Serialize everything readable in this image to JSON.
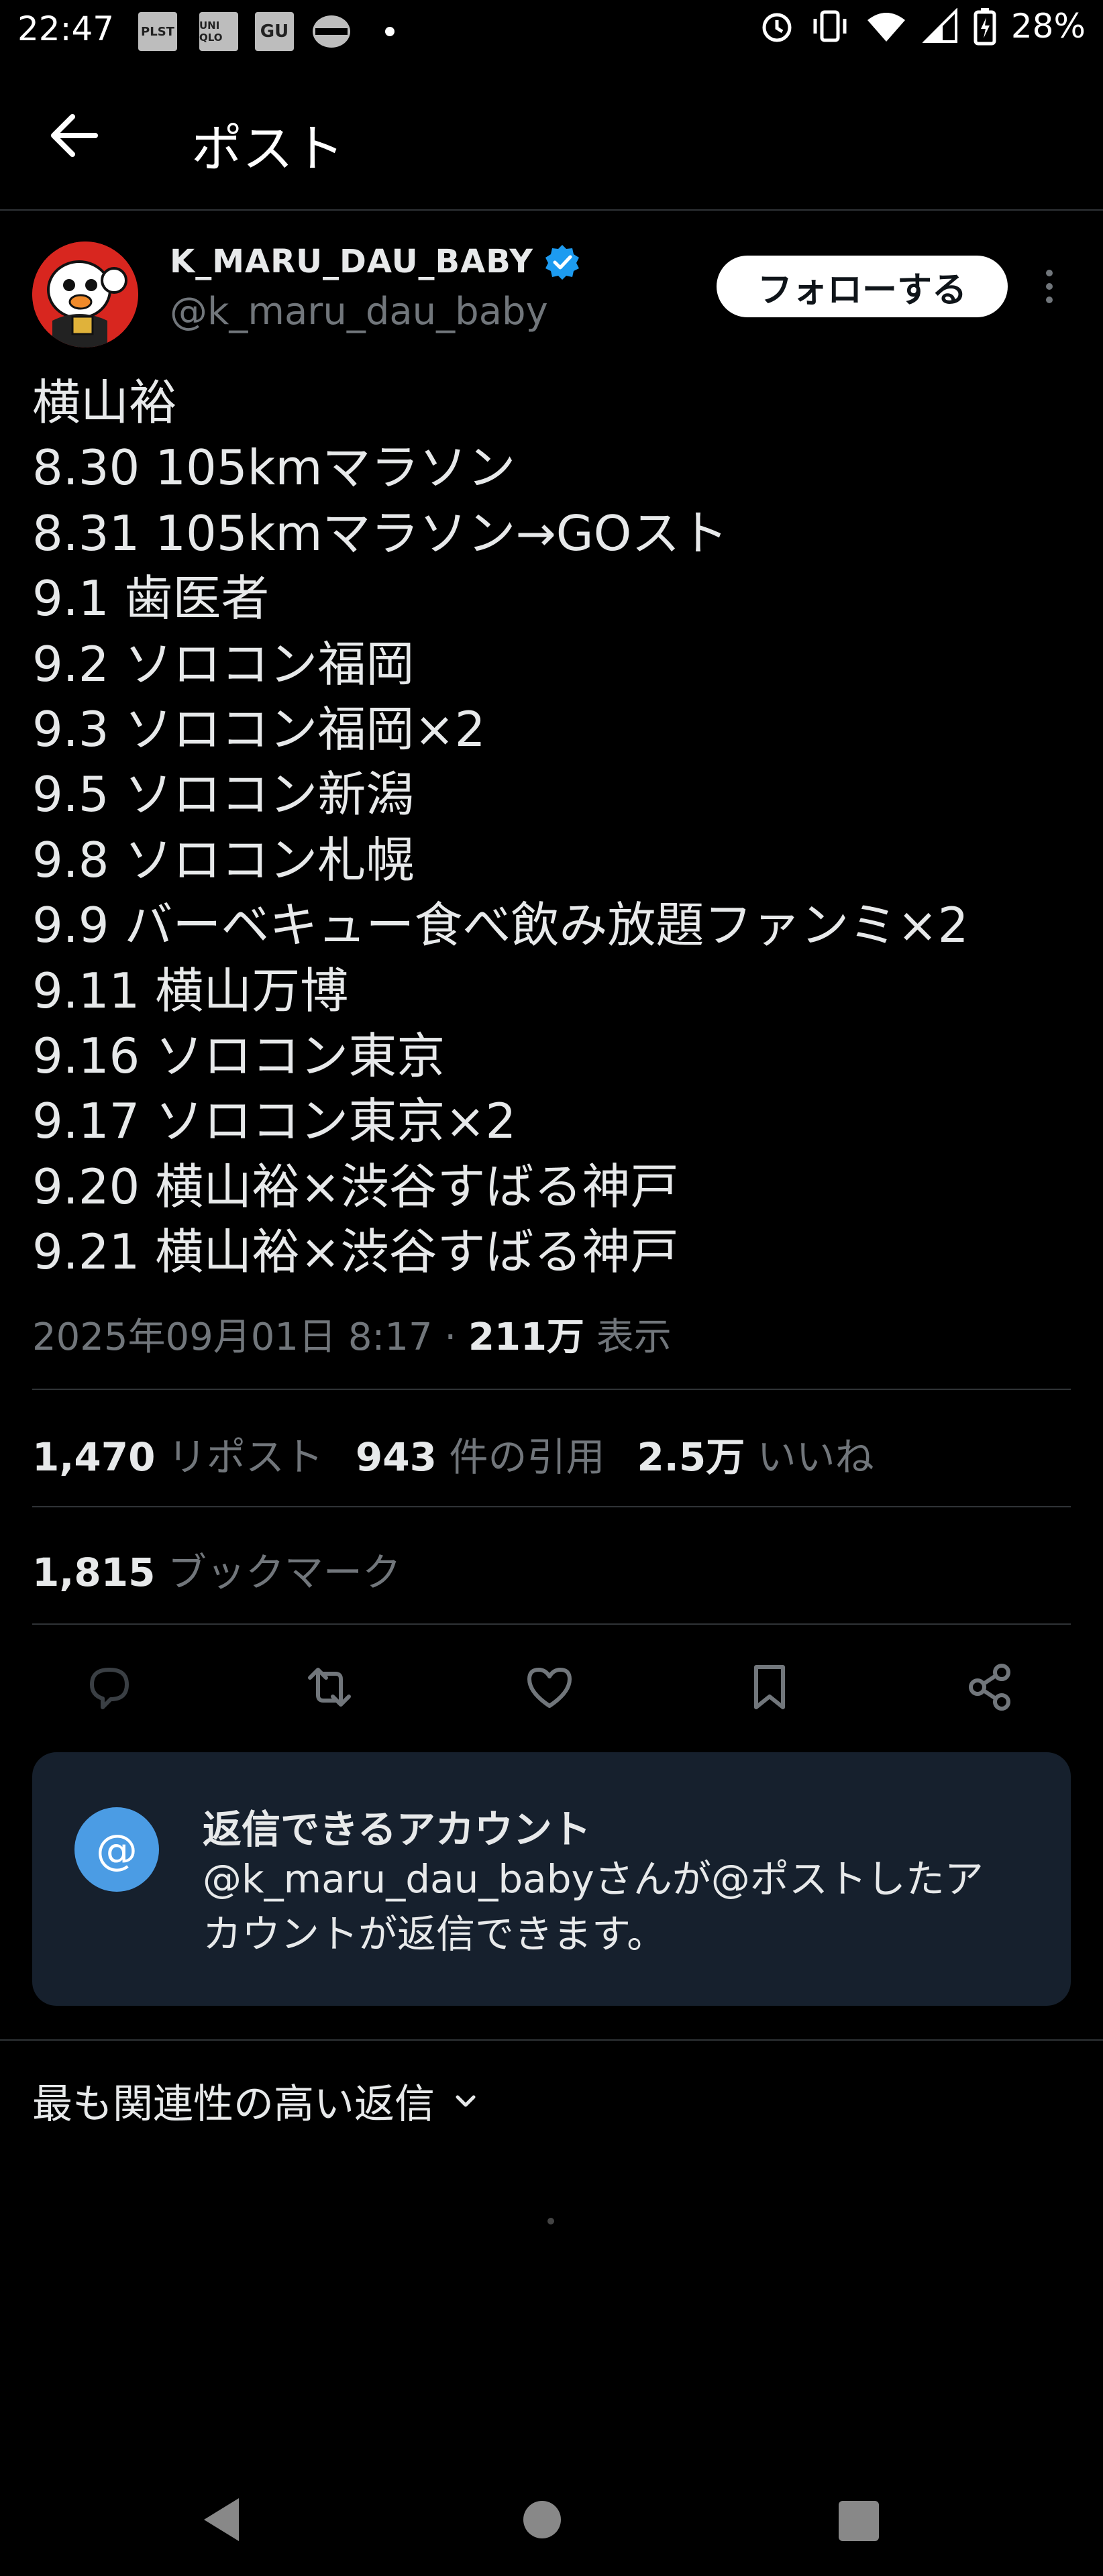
{
  "status_bar": {
    "time": "22:47",
    "apps": [
      "PLST",
      "UNI QLO",
      "GU"
    ],
    "battery": "28%"
  },
  "header": {
    "title": "ポスト"
  },
  "author": {
    "display_name": "K_MARU_DAU_BABY",
    "handle": "@k_maru_dau_baby",
    "verified": true,
    "follow_label": "フォローする"
  },
  "post": {
    "lines": [
      "横山裕",
      "8.30 105kmマラソン",
      "8.31 105kmマラソン→GOスト",
      "9.1 歯医者",
      "9.2 ソロコン福岡",
      "9.3 ソロコン福岡×2",
      "9.5 ソロコン新潟",
      "9.8 ソロコン札幌",
      "9.9 バーベキュー食べ飲み放題ファンミ×2",
      "9.11 横山万博",
      "9.16 ソロコン東京",
      "9.17 ソロコン東京×2",
      "9.20 横山裕×渋谷すばる神戸",
      "9.21 横山裕×渋谷すばる神戸"
    ],
    "timestamp": "2025年09月01日 8:17",
    "separator": "·",
    "views_count": "211万",
    "views_label": "表示"
  },
  "stats": {
    "reposts_count": "1,470",
    "reposts_label": "リポスト",
    "quotes_count": "943",
    "quotes_label": "件の引用",
    "likes_count": "2.5万",
    "likes_label": "いいね",
    "bookmarks_count": "1,815",
    "bookmarks_label": "ブックマーク"
  },
  "actions": [
    "reply-icon",
    "repost-icon",
    "like-icon",
    "bookmark-icon",
    "share-icon"
  ],
  "reply_settings": {
    "icon": "@",
    "title": "返信できるアカウント",
    "description": "@k_maru_dau_babyさんが@ポストしたアカウントが返信できます。"
  },
  "replies_sort": {
    "label": "最も関連性の高い返信"
  },
  "colors": {
    "background": "#000000",
    "text": "#e7e9ea",
    "secondary_text": "#71767b",
    "verified_badge": "#1d9bf0",
    "reply_box": "#16202d",
    "reply_icon": "#4b9ce4"
  }
}
